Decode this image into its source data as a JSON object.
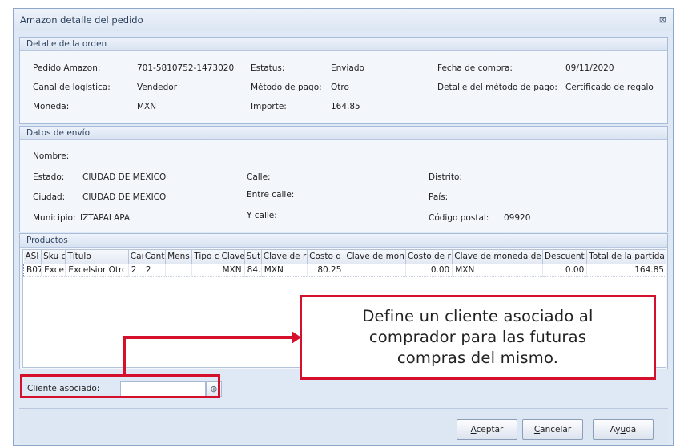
{
  "window": {
    "title": "Amazon detalle del pedido",
    "close_icon": "close-icon"
  },
  "orden": {
    "header": "Detalle de la orden",
    "pedido_label": "Pedido Amazon:",
    "pedido_value": "701-5810752-1473020",
    "estatus_label": "Estatus:",
    "estatus_value": "Enviado",
    "fecha_label": "Fecha de compra:",
    "fecha_value": "09/11/2020",
    "canal_label": "Canal de logística:",
    "canal_value": "Vendedor",
    "metodo_label": "Método de pago:",
    "metodo_value": "Otro",
    "detalle_metodo_label": "Detalle del método de pago:",
    "detalle_metodo_value": "Certificado de regalo",
    "moneda_label": "Moneda:",
    "moneda_value": "MXN",
    "importe_label": "Importe:",
    "importe_value": "164.85"
  },
  "envio": {
    "header": "Datos de envío",
    "nombre_label": "Nombre:",
    "estado_label": "Estado:",
    "estado_value": "CIUDAD DE MEXICO",
    "calle_label": "Calle:",
    "distrito_label": "Distrito:",
    "ciudad_label": "Ciudad:",
    "ciudad_value": "CIUDAD DE MEXICO",
    "entre_calle_label": "Entre calle:",
    "pais_label": "País:",
    "municipio_label": "Municipio:",
    "municipio_value": "IZTAPALAPA",
    "y_calle_label": "Y calle:",
    "cp_label": "Código postal:",
    "cp_value": "09920"
  },
  "productos": {
    "header": "Productos",
    "columns": [
      "ASI",
      "Sku c",
      "Título",
      "Car",
      "Canti",
      "Mens",
      "Tipo c",
      "Clave",
      "Sut",
      "Clave de r",
      "Costo d",
      "Clave de mon",
      "Costo de r",
      "Clave de moneda de",
      "Descuent",
      "Total de la partida"
    ],
    "rows": [
      [
        "B07",
        "Exce",
        "Excelsior Otrc",
        "2",
        "2",
        "",
        "",
        "MXN",
        "84.",
        "MXN",
        "80.25",
        "",
        "0.00",
        "MXN",
        "0.00",
        "164.85"
      ]
    ]
  },
  "cliente": {
    "label": "Cliente asociado:",
    "value": "",
    "lookup_icon": "search-icon"
  },
  "buttons": {
    "aceptar_u": "A",
    "aceptar_rest": "ceptar",
    "cancelar_u": "C",
    "cancelar_rest": "ancelar",
    "ayuda_pre": "Ay",
    "ayuda_u": "u",
    "ayuda_rest": "da"
  },
  "callout": {
    "line1": "Define un cliente asociado al",
    "line2": "comprador para las futuras",
    "line3": "compras del mismo."
  },
  "colors": {
    "highlight": "#d4102d",
    "window_bg": "#dfe8f5",
    "group_border": "#a7bcd8"
  }
}
